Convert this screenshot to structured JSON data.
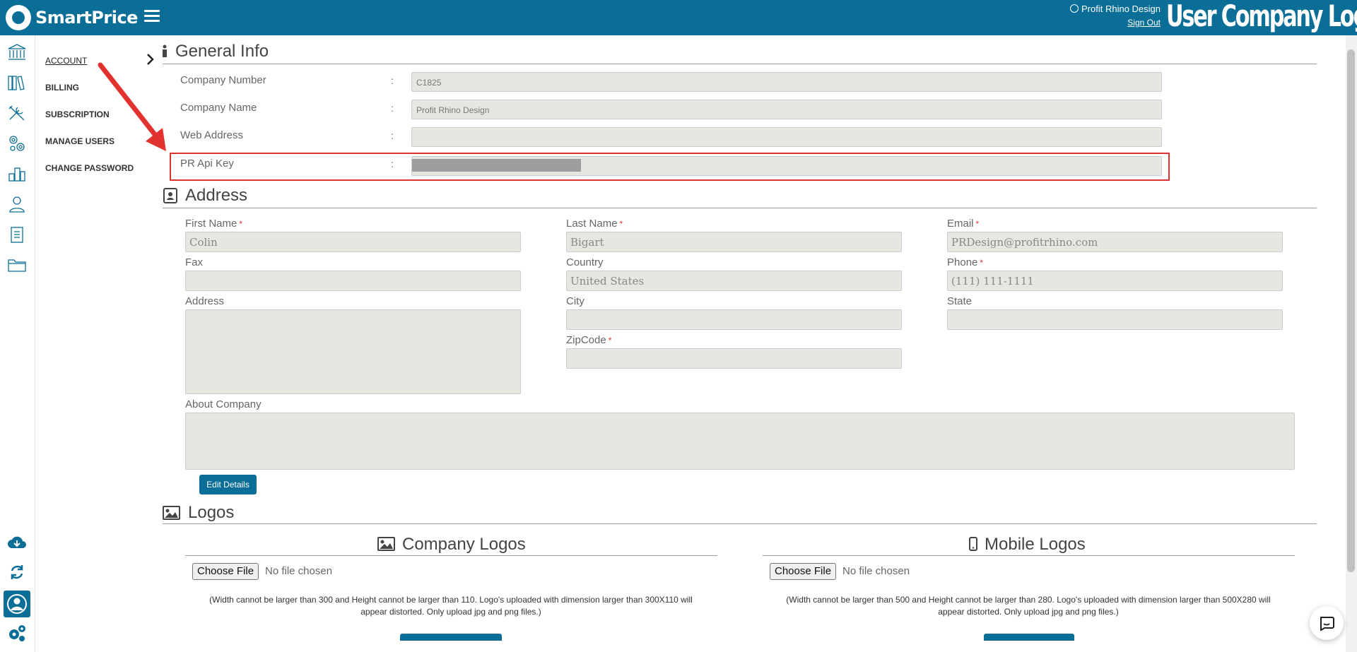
{
  "header": {
    "brand": "SmartPrice",
    "user_name": "Profit Rhino Design",
    "sign_out": "Sign Out",
    "company_logo": "User Company Logo"
  },
  "rail": {
    "icons": [
      "bank-icon",
      "books-icon",
      "tools-icon",
      "gears-icon",
      "buildings-icon",
      "user-icon",
      "clipboard-icon",
      "folder-icon",
      "cloud-download-icon",
      "sync-icon",
      "profile-icon",
      "settings-icon"
    ]
  },
  "subnav": {
    "items": [
      "ACCOUNT",
      "BILLING",
      "SUBSCRIPTION",
      "MANAGE USERS",
      "CHANGE PASSWORD"
    ],
    "active": "ACCOUNT"
  },
  "general": {
    "title": "General Info",
    "fields": [
      {
        "label": "Company Number",
        "value": "C1825"
      },
      {
        "label": "Company Name",
        "value": "Profit Rhino Design"
      },
      {
        "label": "Web Address",
        "value": ""
      },
      {
        "label": "PR Api Key",
        "value": ""
      }
    ],
    "colon": ":"
  },
  "address": {
    "title": "Address",
    "first_name": {
      "label": "First Name",
      "value": "Colin",
      "required": true
    },
    "last_name": {
      "label": "Last Name",
      "value": "Bigart",
      "required": true
    },
    "email": {
      "label": "Email",
      "value": "PRDesign@profitrhino.com",
      "required": true
    },
    "fax": {
      "label": "Fax",
      "value": ""
    },
    "country": {
      "label": "Country",
      "value": "United States"
    },
    "phone": {
      "label": "Phone",
      "value": "(111) 111-1111",
      "required": true
    },
    "address": {
      "label": "Address",
      "value": ""
    },
    "city": {
      "label": "City",
      "value": ""
    },
    "state": {
      "label": "State",
      "value": ""
    },
    "zipcode": {
      "label": "ZipCode",
      "value": "",
      "required": true
    },
    "about": {
      "label": "About Company",
      "value": ""
    },
    "required_mark": "*",
    "edit_button": "Edit Details"
  },
  "logos": {
    "title": "Logos",
    "company": {
      "title": "Company Logos",
      "choose_file": "Choose File",
      "status": "No file chosen",
      "hint": "(Width cannot be larger than 300 and Height cannot be larger than 110. Logo's uploaded with dimension larger than 300X110 will appear distorted. Only upload jpg and png files.)"
    },
    "mobile": {
      "title": "Mobile Logos",
      "choose_file": "Choose File",
      "status": "No file chosen",
      "hint": "(Width cannot be larger than 500 and Height cannot be larger than 280. Logo's uploaded with dimension larger than 500X280 will appear distorted. Only upload jpg and png files.)"
    }
  },
  "colors": {
    "brand": "#0b6e96",
    "highlight": "#e2322f",
    "input_bg": "#e8e6e1"
  }
}
